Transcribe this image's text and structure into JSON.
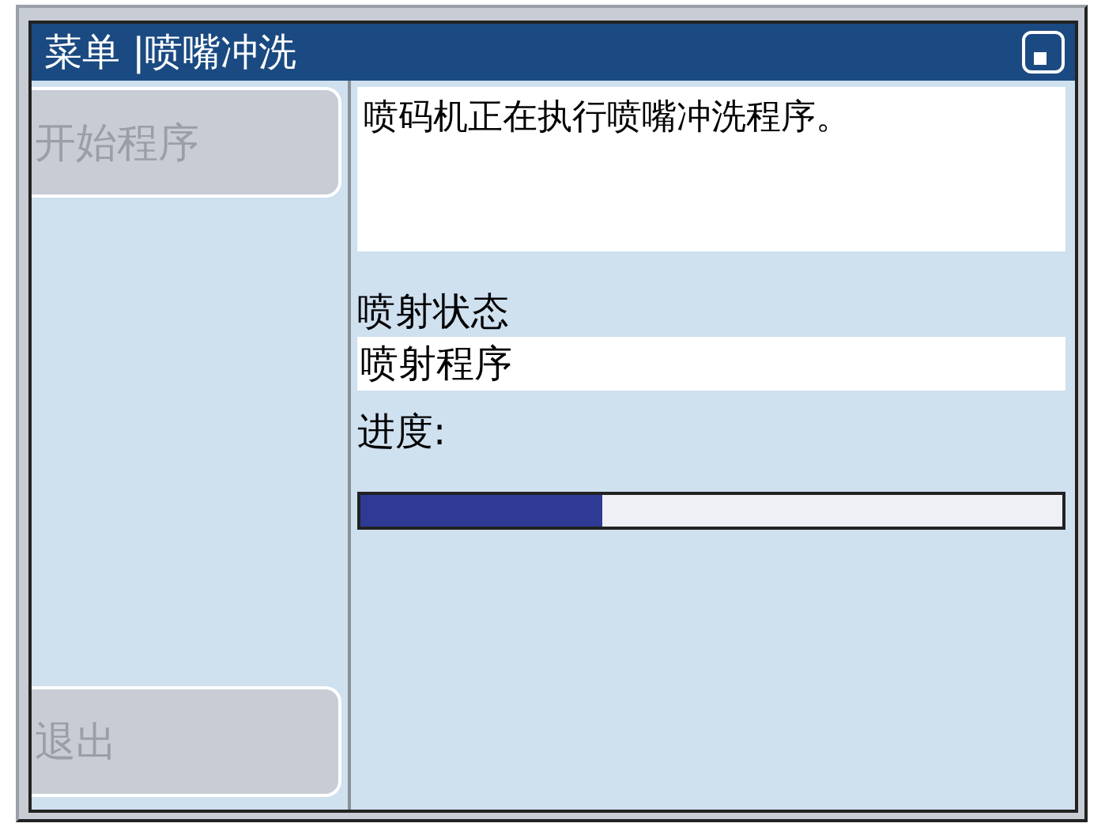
{
  "window": {
    "title": "菜单 |喷嘴冲洗"
  },
  "buttons": [
    {
      "label": "开始程序",
      "disabled": true
    },
    {
      "label": "退出",
      "disabled": true
    }
  ],
  "message": "喷码机正在执行喷嘴冲洗程序。",
  "status": {
    "label": "喷射状态",
    "value": "喷射程序"
  },
  "progress": {
    "label": "进度:",
    "level": 0.345
  }
}
